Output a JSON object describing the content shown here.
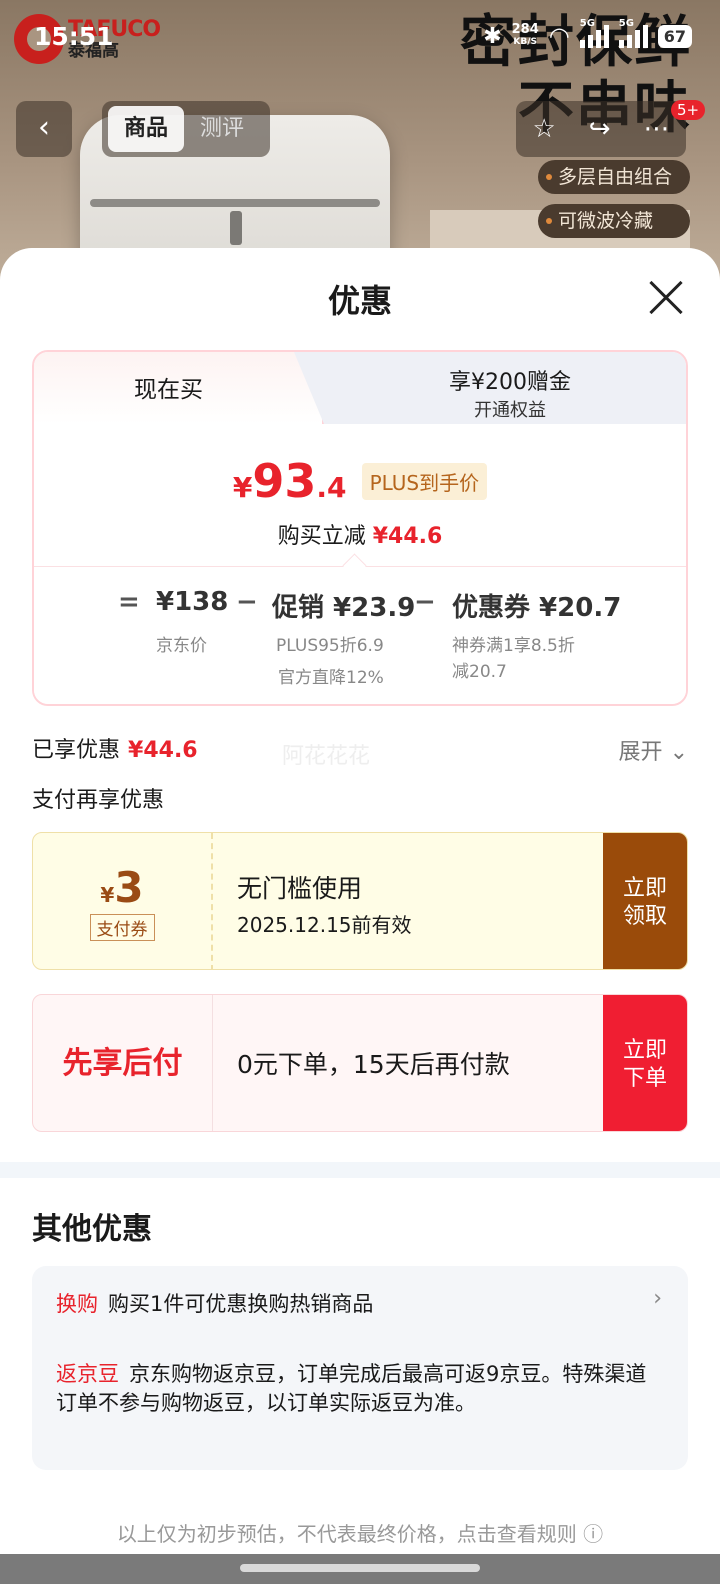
{
  "status": {
    "time": "15:51",
    "speed": "284",
    "speed_unit": "KB/S",
    "battery": "67",
    "net1": "5G",
    "net2": "5G"
  },
  "background": {
    "brand_en": "TAFUCO",
    "brand_cn": "泰福高",
    "slogan_line1": "密封保鲜",
    "slogan_line2": "不串味",
    "features": [
      "多层自由组合",
      "可微波冷藏",
      ""
    ]
  },
  "nav": {
    "tab_goods": "商品",
    "tab_review": "测评",
    "badge": "5+"
  },
  "sheet": {
    "title": "优惠",
    "price_card": {
      "tab_now": "现在买",
      "tab_plus_line1": "享¥200赠金",
      "tab_plus_line2": "开通权益",
      "price_symbol": "¥",
      "price_int": "93",
      "price_dec": ".4",
      "plus_tag": "PLUS到手价",
      "reduce_label": "购买立减",
      "reduce_amount": "¥44.6",
      "eq": "=",
      "minus1": "−",
      "minus2": "−",
      "jd_price": "¥138",
      "jd_price_label": "京东价",
      "promo_value": "促销 ¥23.9",
      "promo_sub1": "PLUS95折6.9",
      "promo_sub2": "官方直降12%",
      "coupon_value": "优惠券 ¥20.7",
      "coupon_sub1": "神券满1享8.5折",
      "coupon_sub2": "减20.7"
    },
    "saved_label": "已享优惠",
    "saved_amount": "¥44.6",
    "watermark": "阿花花花",
    "expand_label": "展开",
    "pay_more_label": "支付再享优惠",
    "pay_coupon": {
      "symbol": "¥",
      "value": "3",
      "tag": "支付券",
      "title": "无门槛使用",
      "validity": "2025.12.15前有效",
      "btn_line1": "立即",
      "btn_line2": "领取"
    },
    "pay_later": {
      "title": "先享后付",
      "desc": "0元下单，15天后再付款",
      "btn_line1": "立即",
      "btn_line2": "下单"
    },
    "other_title": "其他优惠",
    "other": [
      {
        "key": "换购",
        "text": "购买1件可优惠换购热销商品"
      },
      {
        "key": "返京豆",
        "text": "京东购物返京豆，订单完成后最高可返9京豆。特殊渠道订单不参与购物返豆，以订单实际返豆为准。"
      }
    ],
    "footer_note": "以上仅为初步预估，不代表最终价格，点击查看规则 ⓘ"
  },
  "colors": {
    "accent_red": "#e8232c",
    "coupon_brown": "#9a4b0a",
    "plus_gold": "#b5651d"
  }
}
